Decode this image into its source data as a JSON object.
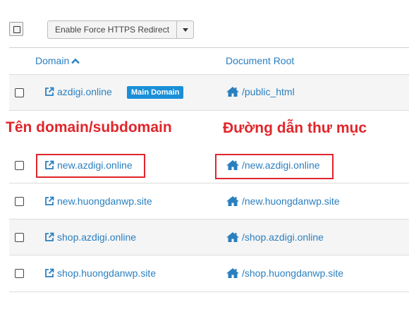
{
  "toolbar": {
    "bulk_action_label": "Enable Force HTTPS Redirect"
  },
  "table": {
    "col_domain": "Domain",
    "col_root": "Document Root",
    "rows": [
      {
        "domain": "azdigi.online",
        "root": "/public_html",
        "badge": "Main Domain"
      },
      {
        "domain": "new.azdigi.online",
        "root": "/new.azdigi.online"
      },
      {
        "domain": "new.huongdanwp.site",
        "root": "/new.huongdanwp.site"
      },
      {
        "domain": "shop.azdigi.online",
        "root": "/shop.azdigi.online"
      },
      {
        "domain": "shop.huongdanwp.site",
        "root": "/shop.huongdanwp.site"
      }
    ]
  },
  "annotations": {
    "domain_label": "Tên domain/subdomain",
    "root_label": "Đường dẫn thư mục"
  },
  "colors": {
    "link": "#2a7fbf",
    "badge": "#1a8fd8",
    "annotation": "#e0262b"
  }
}
